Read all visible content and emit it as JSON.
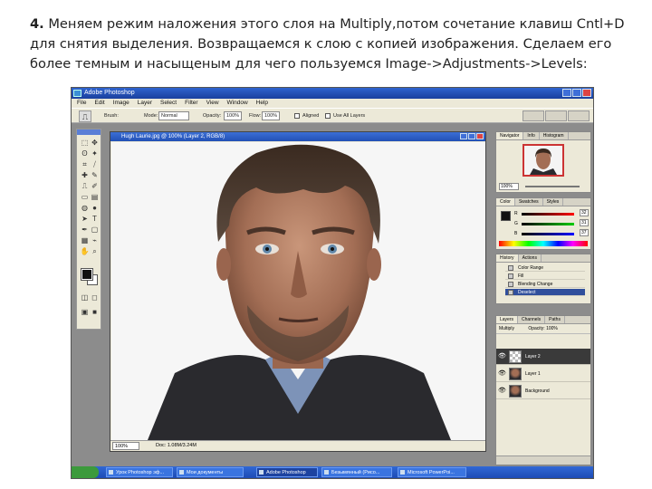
{
  "caption": {
    "step": "4.",
    "line1": "Меняем режим наложения этого слоя на Multiply,потом сочетание клавиш Cntl+D",
    "line2": "для снятия выделения. Возвращаемся к слою с копией изображения. Сделаем его",
    "line3": "более темным и насыщеным для чего пользуемся Image->Adjustments->Levels:"
  },
  "window": {
    "title": "Adobe Photoshop"
  },
  "menubar": [
    "File",
    "Edit",
    "Image",
    "Layer",
    "Select",
    "Filter",
    "View",
    "Window",
    "Help"
  ],
  "options": {
    "brush_label": "Brush:",
    "mode_label": "Mode:",
    "mode_value": "Normal",
    "opacity_label": "Opacity:",
    "opacity_value": "100%",
    "flow_label": "Flow:",
    "flow_value": "100%",
    "aligned_label": "Aligned",
    "use_all_layers_label": "Use All Layers"
  },
  "document": {
    "title": "Hugh Laurie.jpg @ 100% (Layer 2, RGB/8)",
    "zoom": "100%",
    "status": "Doc: 1.08M/3.24M"
  },
  "panels": {
    "navigator": {
      "tabs": [
        "Navigator",
        "Info",
        "Histogram"
      ],
      "zoom": "100%"
    },
    "color": {
      "tabs": [
        "Color",
        "Swatches",
        "Styles"
      ],
      "rows": [
        {
          "label": "R",
          "value": "32"
        },
        {
          "label": "G",
          "value": "31"
        },
        {
          "label": "B",
          "value": "37"
        }
      ]
    },
    "history": {
      "tabs": [
        "History",
        "Actions"
      ],
      "states": [
        "Color Range",
        "Fill",
        "Blending Change",
        "Deselect"
      ]
    },
    "layers": {
      "tabs": [
        "Layers",
        "Channels",
        "Paths"
      ],
      "blend": "Multiply",
      "opacity": "Opacity: 100%",
      "items": [
        {
          "name": "Layer 2",
          "active": true
        },
        {
          "name": "Layer 1",
          "active": false
        },
        {
          "name": "Background",
          "active": false
        }
      ]
    }
  },
  "taskbar": {
    "tasks": [
      "Урок Photoshop эф...",
      "Мои документы",
      "Adobe Photoshop",
      "Безымянный (Рисо...",
      "Microsoft PowerPoi..."
    ]
  },
  "colors": {
    "titlebar": "#2f63cf",
    "chrome": "#ece9d8",
    "workspace": "#8c8c8c",
    "selection": "#304f9c"
  }
}
